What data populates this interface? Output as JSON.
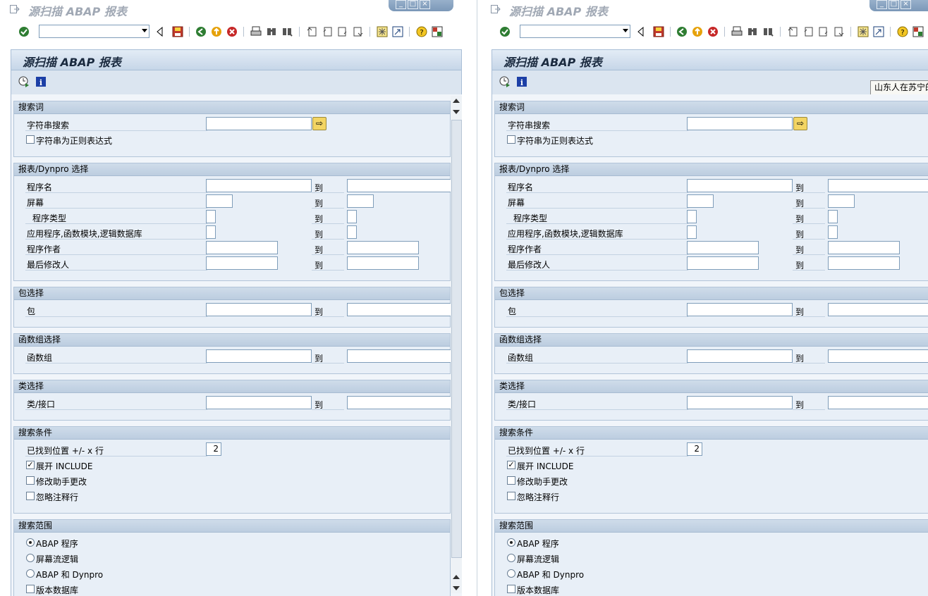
{
  "window_title": "源扫描 ABAP 报表",
  "screen_title": "源扫描 ABAP 报表",
  "tooltip_text": "山东人在苏宁的",
  "to_label": "到",
  "colors": {
    "header_bg": "#c6d6e8",
    "group_bg": "#e8eff7",
    "exec_button": "#f3d563"
  },
  "toolbar": {
    "command_field_value": "",
    "icons": [
      "enter-icon",
      "back-arrow-icon",
      "save-icon",
      "back-icon",
      "exit-icon",
      "cancel-icon",
      "print-icon",
      "find-icon",
      "find-next-icon",
      "first-page-icon",
      "prev-page-icon",
      "next-page-icon",
      "last-page-icon",
      "new-session-icon",
      "shortcut-icon",
      "help-icon",
      "layout-icon"
    ]
  },
  "app_toolbar": {
    "icons": [
      "execute-icon",
      "info-icon"
    ]
  },
  "groups": {
    "search_term": {
      "title": "搜索词",
      "string_search_label": "字符串搜索",
      "string_search_value": "",
      "regex_label": "字符串为正则表达式",
      "regex_checked": false
    },
    "report_dynpro": {
      "title": "报表/Dynpro 选择",
      "rows": [
        {
          "label": "程序名",
          "from": "",
          "to": ""
        },
        {
          "label": "屏幕",
          "from": "",
          "to": ""
        },
        {
          "label": "程序类型",
          "from": "",
          "to": ""
        },
        {
          "label": "应用程序,函数模块,逻辑数据库",
          "from": "",
          "to": ""
        },
        {
          "label": "程序作者",
          "from": "",
          "to": ""
        },
        {
          "label": "最后修改人",
          "from": "",
          "to": ""
        }
      ]
    },
    "package": {
      "title": "包选择",
      "label": "包"
    },
    "function_group": {
      "title": "函数组选择",
      "label": "函数组"
    },
    "class": {
      "title": "类选择",
      "label": "类/接口"
    },
    "search_conditions": {
      "title": "搜索条件",
      "lines_label": "已找到位置 +/- x 行",
      "lines_value": "2",
      "expand_include_label": "展开 INCLUDE",
      "expand_include_checked": true,
      "mod_assistant_label": "修改助手更改",
      "mod_assistant_checked": false,
      "ignore_comments_label": "忽略注释行",
      "ignore_comments_checked": false
    },
    "search_range": {
      "title": "搜索范围",
      "abap_program_label": "ABAP 程序",
      "screen_flow_label": "屏幕流逻辑",
      "abap_dynpro_label": "ABAP 和 Dynpro",
      "selected": "abap_program",
      "version_db_label": "版本数据库",
      "version_db_checked": false
    }
  }
}
